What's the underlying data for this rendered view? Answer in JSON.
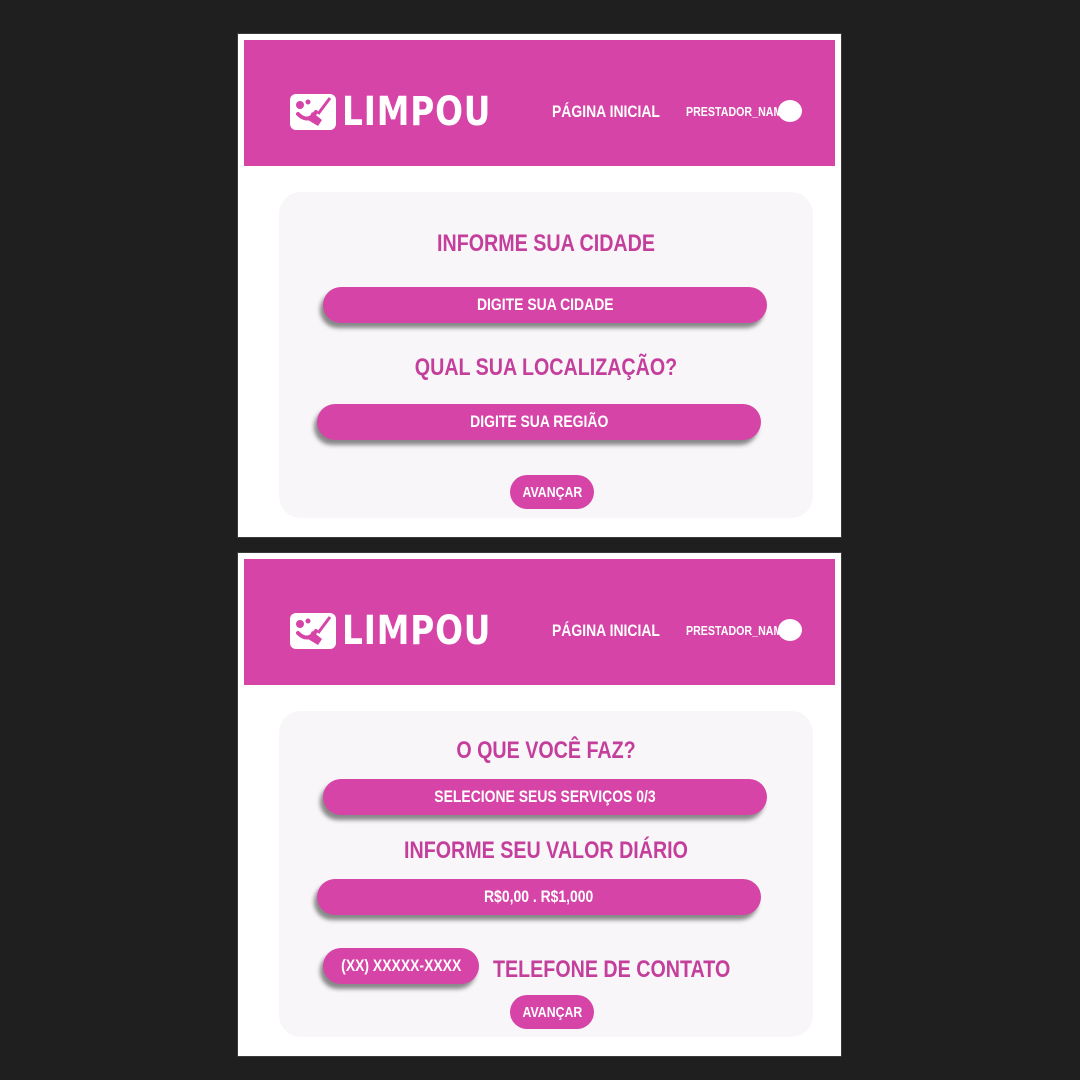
{
  "brand": {
    "name": "LIMPOU"
  },
  "colors": {
    "primary": "#d544a6",
    "text_accent": "#c43f9c",
    "card_bg": "#f8f6f8",
    "page_bg": "#1f1f1f"
  },
  "screen1": {
    "nav": {
      "home": "PÁGINA INICIAL",
      "user": "PRESTADOR_NAME"
    },
    "city_question": "INFORME SUA CIDADE",
    "city_input": "DIGITE SUA CIDADE",
    "location_question": "QUAL SUA LOCALIZAÇÃO?",
    "region_input": "DIGITE SUA REGIÃO",
    "next_button": "AVANÇAR"
  },
  "screen2": {
    "nav": {
      "home": "PÁGINA INICIAL",
      "user": "PRESTADOR_NAME"
    },
    "services_question": "O QUE VOCÊ FAZ?",
    "services_select": "SELECIONE SEUS SERVIÇOS 0/3",
    "rate_question": "INFORME SEU VALOR DIÁRIO",
    "rate_range": "R$0,00 . R$1,000",
    "phone_input": "(XX) XXXXX-XXXX",
    "phone_label": "TELEFONE DE CONTATO",
    "next_button": "AVANÇAR"
  }
}
